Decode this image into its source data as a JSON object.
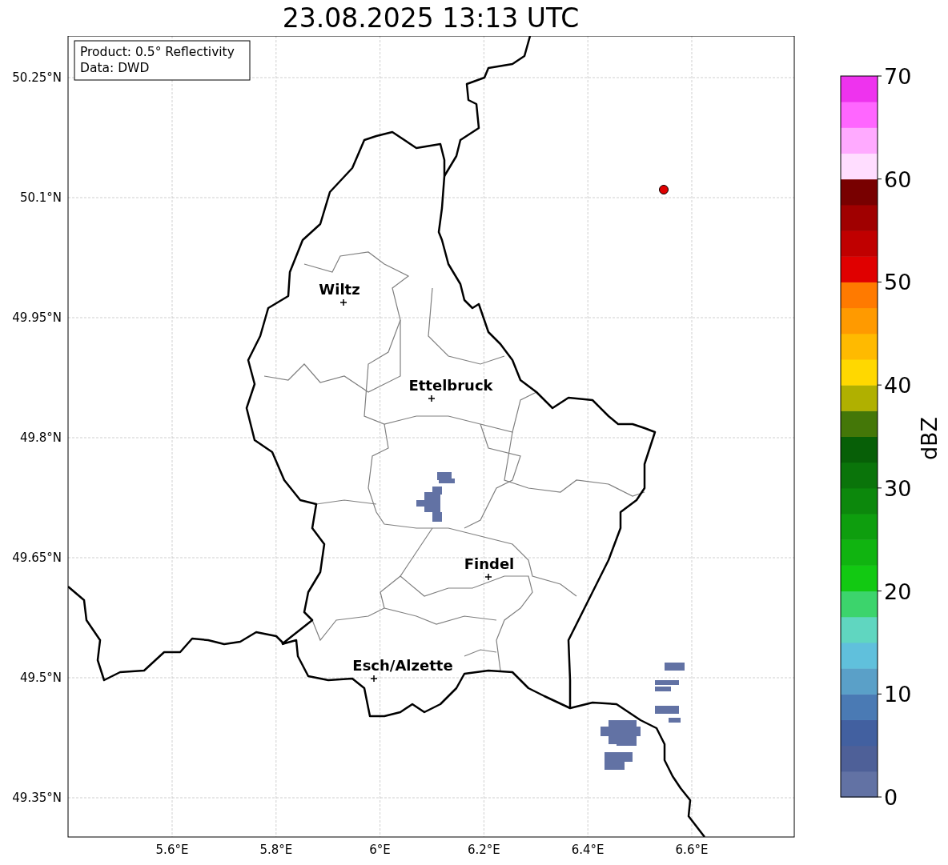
{
  "title": "23.08.2025 13:13 UTC",
  "info_box": {
    "lines": [
      "Product: 0.5° Reflectivity",
      "Data: DWD"
    ]
  },
  "map": {
    "lat_ticks": [
      "50.25°N",
      "50.1°N",
      "49.95°N",
      "49.8°N",
      "49.65°N",
      "49.5°N",
      "49.35°N"
    ],
    "lon_ticks": [
      "5.6°E",
      "5.8°E",
      "6°E",
      "6.2°E",
      "6.4°E",
      "6.6°E"
    ],
    "cities": [
      {
        "name": "Wiltz"
      },
      {
        "name": "Ettelbruck"
      },
      {
        "name": "Findel"
      },
      {
        "name": "Esch/Alzette"
      }
    ]
  },
  "colorbar": {
    "label": "dBZ",
    "ticks": [
      "70",
      "60",
      "50",
      "40",
      "30",
      "20",
      "10",
      "0"
    ],
    "bins": [
      {
        "color": "#6272a4"
      },
      {
        "color": "#4e6098"
      },
      {
        "color": "#4260a0"
      },
      {
        "color": "#4a7ab4"
      },
      {
        "color": "#5aa0c8"
      },
      {
        "color": "#60c0dc"
      },
      {
        "color": "#60d6c0"
      },
      {
        "color": "#3cd46c"
      },
      {
        "color": "#12c912"
      },
      {
        "color": "#10b410"
      },
      {
        "color": "#0e9e0e"
      },
      {
        "color": "#0c880c"
      },
      {
        "color": "#0a740a"
      },
      {
        "color": "#075f07"
      },
      {
        "color": "#447708"
      },
      {
        "color": "#b0b000"
      },
      {
        "color": "#ffd800"
      },
      {
        "color": "#ffba00"
      },
      {
        "color": "#ff9a00"
      },
      {
        "color": "#ff7a00"
      },
      {
        "color": "#e00000"
      },
      {
        "color": "#c00000"
      },
      {
        "color": "#a00000"
      },
      {
        "color": "#780000"
      },
      {
        "color": "#ffddff"
      },
      {
        "color": "#ffaaff"
      },
      {
        "color": "#ff66ff"
      },
      {
        "color": "#ee33ee"
      }
    ]
  }
}
